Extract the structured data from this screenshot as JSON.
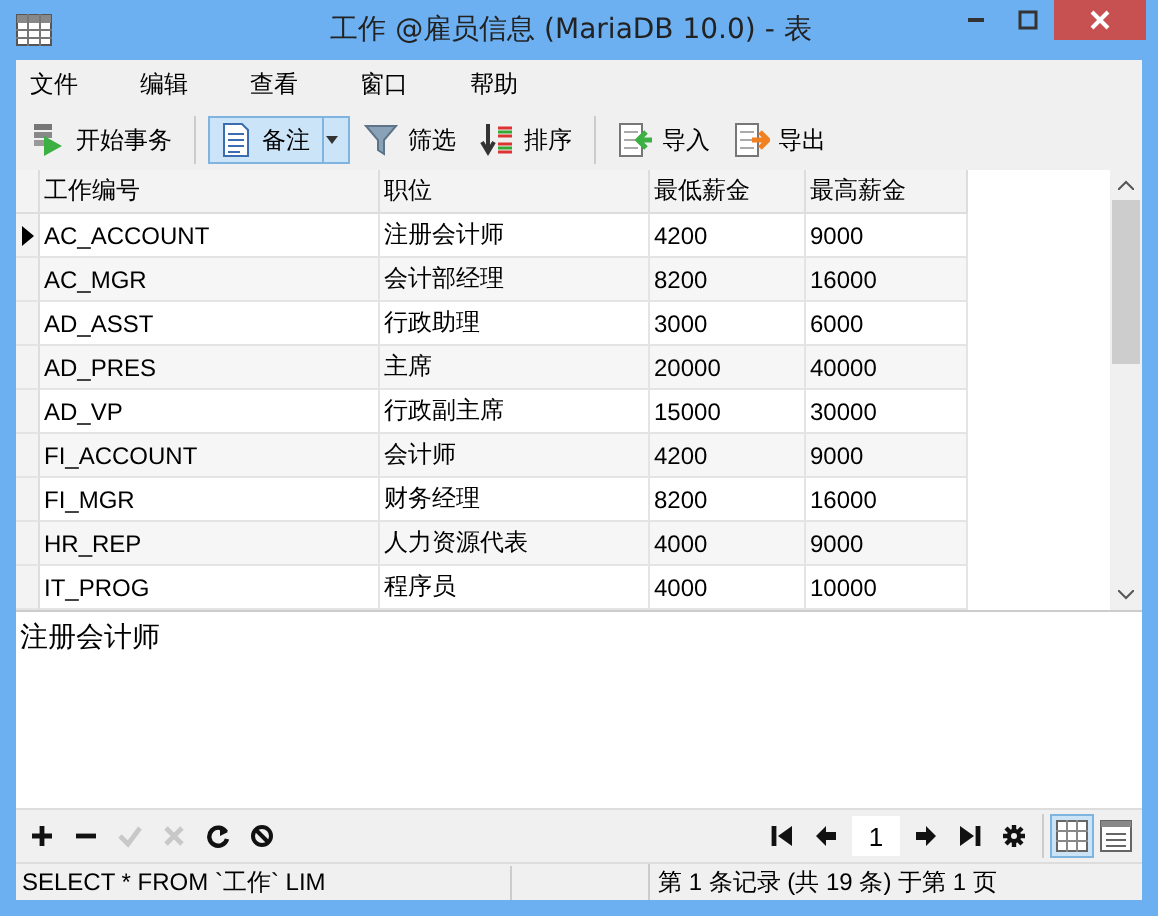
{
  "window": {
    "title": "工作 @雇员信息 (MariaDB 10.0) - 表"
  },
  "menu": [
    {
      "label": "文件"
    },
    {
      "label": "编辑"
    },
    {
      "label": "查看"
    },
    {
      "label": "窗口"
    },
    {
      "label": "帮助"
    }
  ],
  "toolbar": [
    [
      {
        "kind": "transaction",
        "label": "开始事务",
        "pressed": false
      }
    ],
    [
      {
        "kind": "memo",
        "label": "备注",
        "pressed": true
      },
      {
        "kind": "filter",
        "label": "筛选",
        "pressed": false
      },
      {
        "kind": "sort",
        "label": "排序",
        "pressed": false
      }
    ],
    [
      {
        "kind": "import",
        "label": "导入",
        "pressed": false
      },
      {
        "kind": "export",
        "label": "导出",
        "pressed": false
      }
    ]
  ],
  "grid": {
    "columns": [
      "工作编号",
      "职位",
      "最低薪金",
      "最高薪金"
    ],
    "rows": [
      {
        "current": true,
        "cells": [
          "AC_ACCOUNT",
          "注册会计师",
          "4200",
          "9000"
        ]
      },
      {
        "current": false,
        "cells": [
          "AC_MGR",
          "会计部经理",
          "8200",
          "16000"
        ]
      },
      {
        "current": false,
        "cells": [
          "AD_ASST",
          "行政助理",
          "3000",
          "6000"
        ]
      },
      {
        "current": false,
        "cells": [
          "AD_PRES",
          "主席",
          "20000",
          "40000"
        ]
      },
      {
        "current": false,
        "cells": [
          "AD_VP",
          "行政副主席",
          "15000",
          "30000"
        ]
      },
      {
        "current": false,
        "cells": [
          "FI_ACCOUNT",
          "会计师",
          "4200",
          "9000"
        ]
      },
      {
        "current": false,
        "cells": [
          "FI_MGR",
          "财务经理",
          "8200",
          "16000"
        ]
      },
      {
        "current": false,
        "cells": [
          "HR_REP",
          "人力资源代表",
          "4000",
          "9000"
        ]
      },
      {
        "current": false,
        "cells": [
          "IT_PROG",
          "程序员",
          "4000",
          "10000"
        ]
      }
    ]
  },
  "memo": {
    "value": "注册会计师"
  },
  "record_buttons": [
    {
      "kind": "add",
      "disabled": false
    },
    {
      "kind": "delete",
      "disabled": false
    },
    {
      "kind": "apply",
      "disabled": true
    },
    {
      "kind": "cancel",
      "disabled": true
    },
    {
      "kind": "refresh",
      "disabled": false
    },
    {
      "kind": "stop",
      "disabled": false
    }
  ],
  "pager": {
    "page": "1"
  },
  "page_buttons": [
    {
      "kind": "first"
    },
    {
      "kind": "prev"
    },
    {
      "kind": "page"
    },
    {
      "kind": "next"
    },
    {
      "kind": "last"
    },
    {
      "kind": "settings"
    }
  ],
  "views": [
    {
      "kind": "grid",
      "selected": true
    },
    {
      "kind": "form",
      "selected": false
    }
  ],
  "status_bar": {
    "sql": "SELECT * FROM `工作` LIM",
    "record": "第 1 条记录 (共 19 条) 于第 1 页"
  }
}
